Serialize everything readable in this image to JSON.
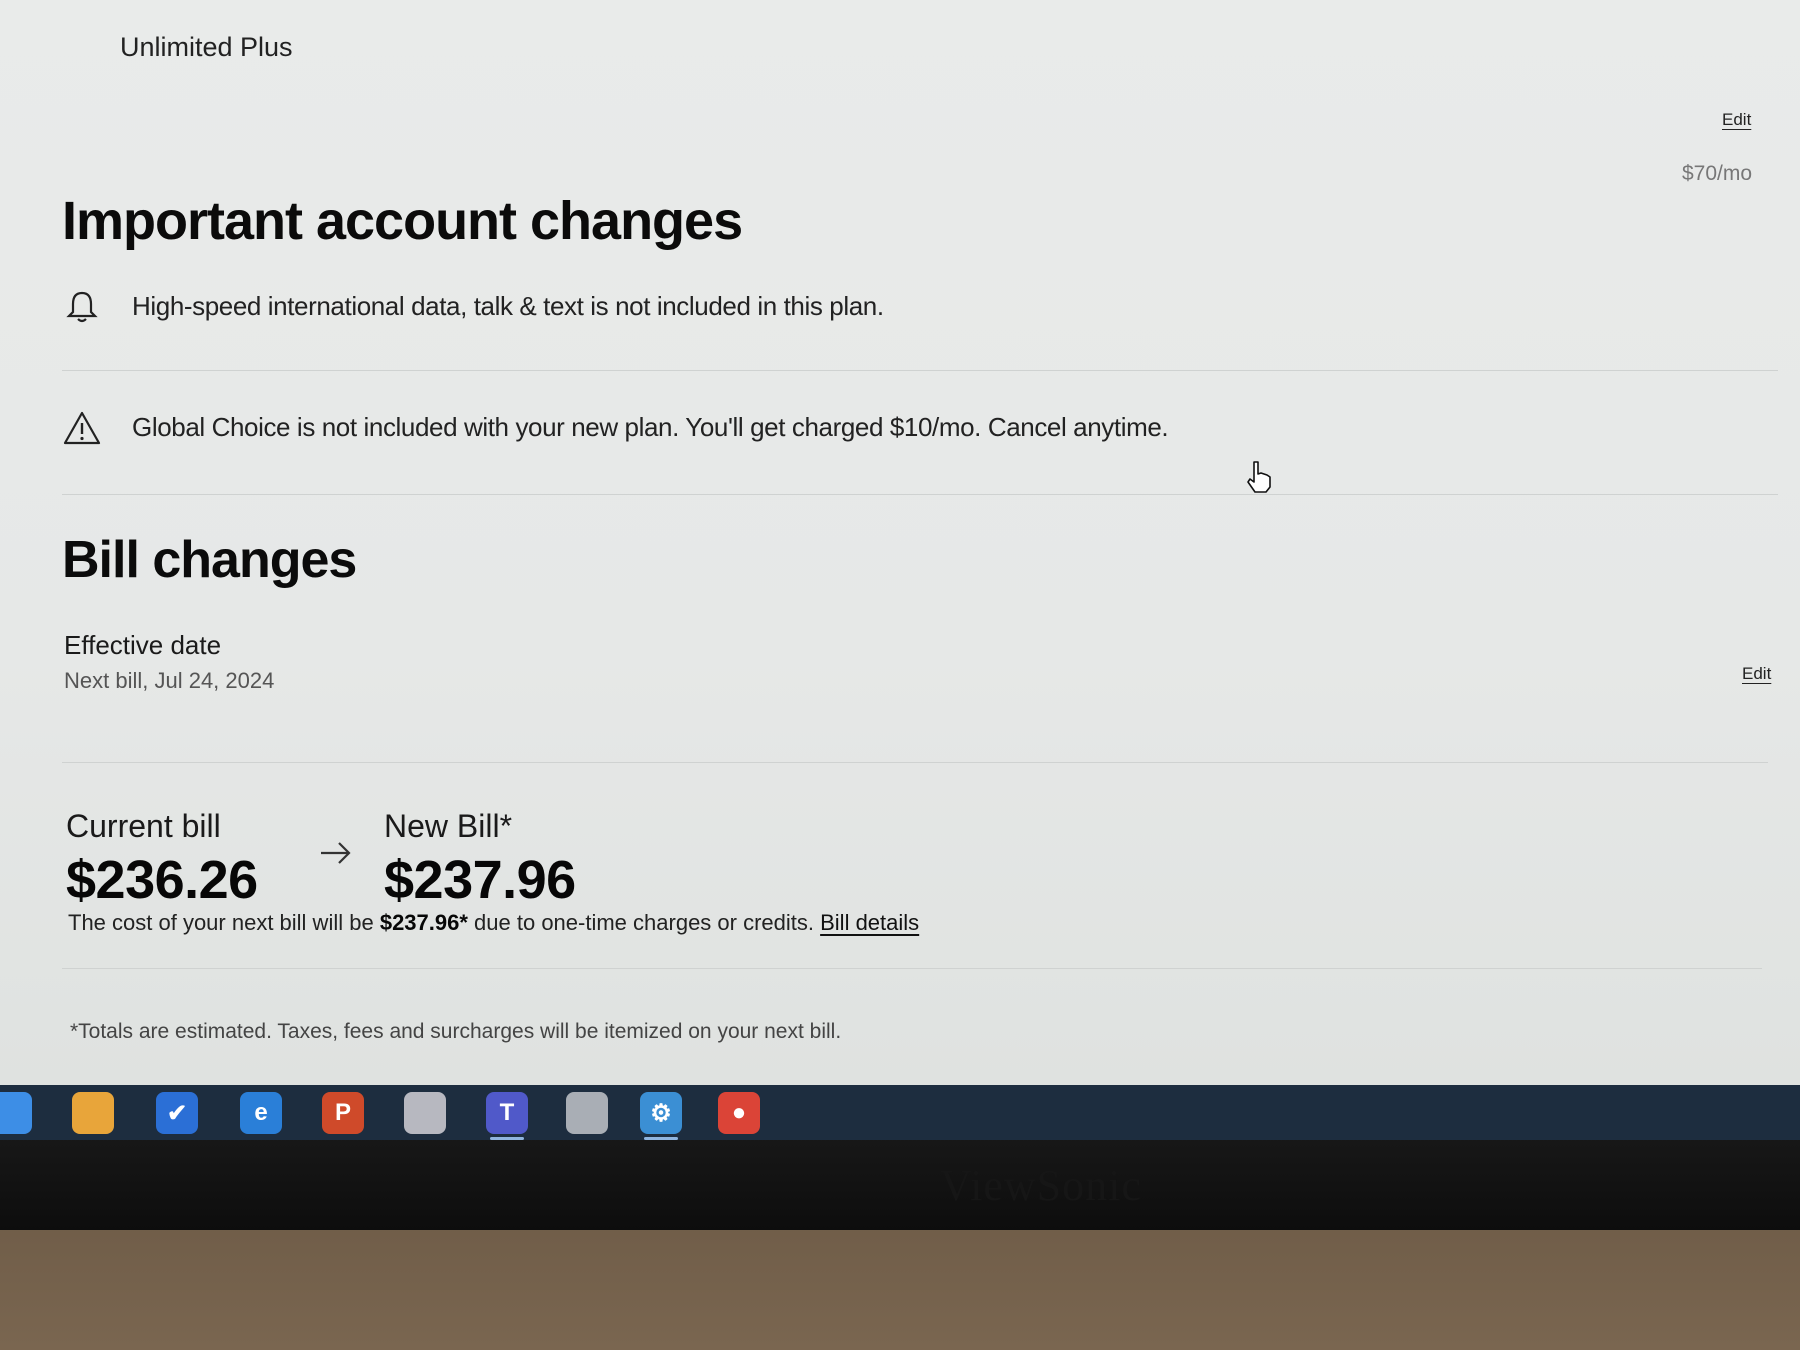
{
  "plan": {
    "name": "Unlimited Plus",
    "edit_label": "Edit",
    "price": "$70/mo"
  },
  "important": {
    "heading": "Important account changes",
    "notices": [
      {
        "icon": "bell-icon",
        "text": "High-speed international data, talk & text is not included in this plan."
      },
      {
        "icon": "warning-icon",
        "text": "Global Choice is not included with your new plan. You'll get charged $10/mo. Cancel anytime."
      }
    ]
  },
  "bill_changes": {
    "heading": "Bill changes",
    "effective_label": "Effective date",
    "effective_value": "Next bill, Jul 24, 2024",
    "edit_label": "Edit",
    "current_label": "Current bill",
    "current_amount": "$236.26",
    "new_label": "New Bill*",
    "new_amount": "$237.96",
    "note_prefix": "The cost of your next bill will be",
    "note_amount": "$237.96*",
    "note_suffix": "due to one-time charges or credits.",
    "details_link": "Bill details",
    "footnote": "*Totals are estimated. Taxes, fees and surcharges will be itemized on your next bill."
  },
  "taskbar": {
    "icons": [
      {
        "name": "explorer-icon",
        "glyph": "",
        "color": "#3d8ee6",
        "active": false
      },
      {
        "name": "file-manager-icon",
        "glyph": "",
        "color": "#e8a53a",
        "active": false
      },
      {
        "name": "todo-icon",
        "glyph": "✔",
        "color": "#2b6fd6",
        "active": false
      },
      {
        "name": "browser-icon",
        "glyph": "e",
        "color": "#2a7fd8",
        "active": false
      },
      {
        "name": "powerpoint-icon",
        "glyph": "P",
        "color": "#cf4a2a",
        "active": false
      },
      {
        "name": "photos-icon",
        "glyph": "",
        "color": "#b7b8c0",
        "active": false
      },
      {
        "name": "teams-icon",
        "glyph": "T",
        "color": "#5059c9",
        "active": true
      },
      {
        "name": "apple-icon",
        "glyph": "",
        "color": "#a9aeb5",
        "active": false
      },
      {
        "name": "network-icon",
        "glyph": "⚙",
        "color": "#3b8fd4",
        "active": true
      },
      {
        "name": "chrome-icon",
        "glyph": "●",
        "color": "#db4437",
        "active": false
      }
    ]
  },
  "monitor": {
    "brand": "ViewSonic"
  }
}
